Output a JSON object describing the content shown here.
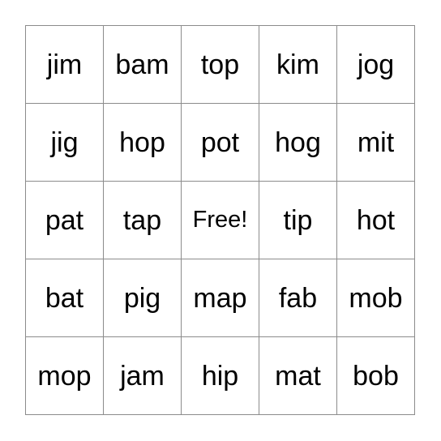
{
  "card": {
    "type": "bingo-card",
    "columns": 5,
    "rows": 5,
    "free_space_label": "Free!",
    "free_space_position": {
      "row": 3,
      "column": 3
    },
    "colors": {
      "background": "#ffffff",
      "grid_line": "#8c8c8c",
      "outer_border": "#5a5a5a",
      "text": "#000000"
    },
    "rows_data": [
      {
        "cells": [
          {
            "text": "jim",
            "is_free": false
          },
          {
            "text": "bam",
            "is_free": false
          },
          {
            "text": "top",
            "is_free": false
          },
          {
            "text": "kim",
            "is_free": false
          },
          {
            "text": "jog",
            "is_free": false
          }
        ]
      },
      {
        "cells": [
          {
            "text": "jig",
            "is_free": false
          },
          {
            "text": "hop",
            "is_free": false
          },
          {
            "text": "pot",
            "is_free": false
          },
          {
            "text": "hog",
            "is_free": false
          },
          {
            "text": "mit",
            "is_free": false
          }
        ]
      },
      {
        "cells": [
          {
            "text": "pat",
            "is_free": false
          },
          {
            "text": "tap",
            "is_free": false
          },
          {
            "text": "Free!",
            "is_free": true
          },
          {
            "text": "tip",
            "is_free": false
          },
          {
            "text": "hot",
            "is_free": false
          }
        ]
      },
      {
        "cells": [
          {
            "text": "bat",
            "is_free": false
          },
          {
            "text": "pig",
            "is_free": false
          },
          {
            "text": "map",
            "is_free": false
          },
          {
            "text": "fab",
            "is_free": false
          },
          {
            "text": "mob",
            "is_free": false
          }
        ]
      },
      {
        "cells": [
          {
            "text": "mop",
            "is_free": false
          },
          {
            "text": "jam",
            "is_free": false
          },
          {
            "text": "hip",
            "is_free": false
          },
          {
            "text": "mat",
            "is_free": false
          },
          {
            "text": "bob",
            "is_free": false
          }
        ]
      }
    ]
  }
}
